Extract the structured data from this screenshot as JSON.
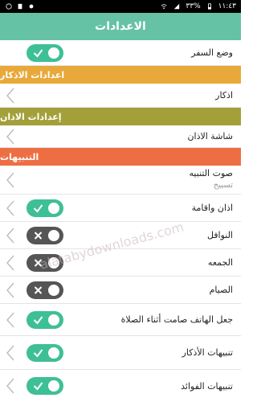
{
  "statusbar": {
    "time": "١١:٤٣",
    "battery": "٣٣%"
  },
  "header": {
    "title": "الاعدادات"
  },
  "rows": {
    "travel_mode": "وضع السفر",
    "adhkar": "اذكار",
    "adhan_screen": "شاشة الاذان",
    "alert_sound": "صوت التنبيه",
    "alert_sound_value": "تسبيح",
    "adhan_iqama": "اذان واقامة",
    "nawafil": "النوافل",
    "jumuah": "الجمعه",
    "siyam": "الصيام",
    "silent_prayer": "جعل الهاتف صامت أثناء الصلاة",
    "adhkar_alerts": "تنبيهات الأذكار",
    "benefits_alerts": "تنبيهات الفوائد"
  },
  "sections": {
    "adhkar_settings": "اعدادات الاذكار",
    "adhan_settings": "إعدادات الاذان",
    "alerts": "التنبيهات"
  },
  "toggles": {
    "travel_mode": true,
    "adhan_iqama": true,
    "nawafil": false,
    "jumuah": false,
    "siyam": false,
    "silent_prayer": true,
    "adhkar_alerts": true,
    "benefits_alerts": true
  },
  "colors": {
    "header": "#66c2a5",
    "section_adhkar": "#e8a93a",
    "section_adhan": "#a3a03a",
    "section_alerts": "#ee6e43",
    "toggle_on": "#3fbf96",
    "toggle_off": "#555555"
  },
  "watermark": "alatabydownloads.com"
}
